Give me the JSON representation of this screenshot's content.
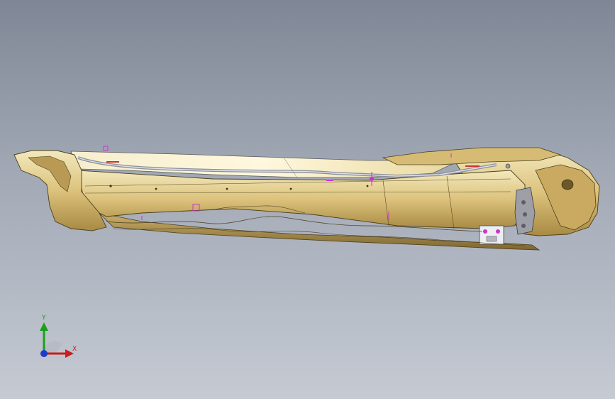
{
  "viewer": {
    "background_top": "#7f8796",
    "background_bottom": "#c5cad3"
  },
  "model": {
    "body_color": "#d9c07a",
    "highlight_color": "#f2e6b4",
    "edge_color": "#4a3e1e",
    "annotation_color": "#cc33cc",
    "bracket_color": "#9e9ea6"
  },
  "triad": {
    "x_label": "X",
    "y_label": "Y",
    "x_color": "#c81e1e",
    "y_color": "#1aa01a",
    "z_color": "#1e3cc8"
  }
}
